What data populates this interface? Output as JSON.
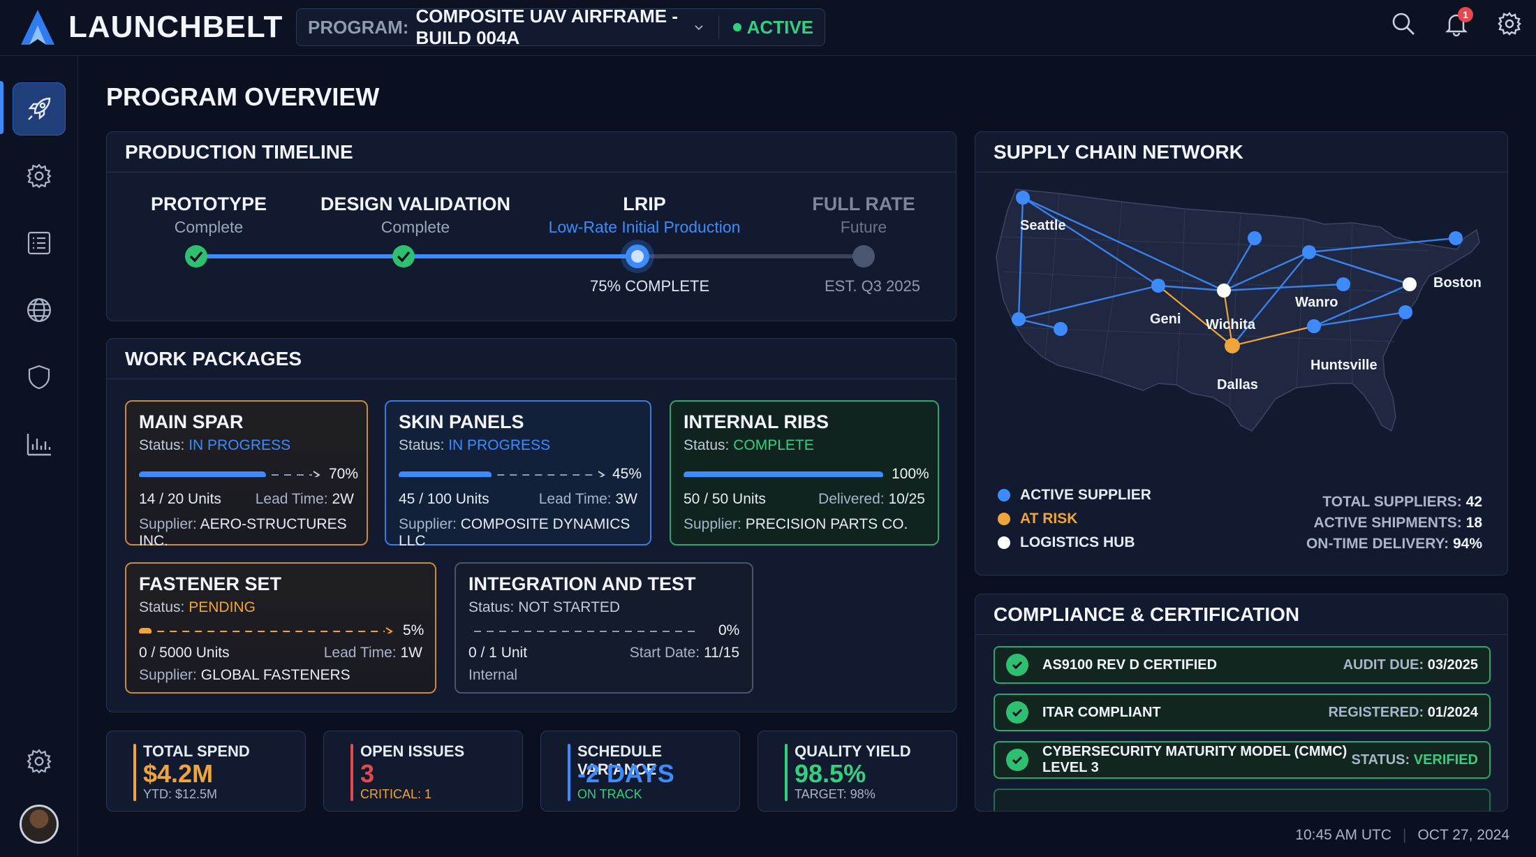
{
  "app": {
    "name": "LAUNCHBELT"
  },
  "program": {
    "label": "PROGRAM:",
    "value": "COMPOSITE UAV AIRFRAME - BUILD 004A",
    "status": "ACTIVE"
  },
  "notifications": {
    "count": "1"
  },
  "colors": {
    "accent": "#3d8bff",
    "success": "#35d07f",
    "warning": "#f0a53a",
    "danger": "#e5484d",
    "background": "#0b1020"
  },
  "icons": {
    "sidebar": [
      "rocket-icon",
      "gear-icon",
      "list-icon",
      "globe-icon",
      "shield-icon",
      "bar-chart-icon",
      "settings-icon"
    ],
    "top": [
      "search-icon",
      "bell-icon",
      "gear-icon"
    ]
  },
  "page": {
    "title": "PROGRAM OVERVIEW"
  },
  "timeline": {
    "title": "PRODUCTION TIMELINE",
    "progress": 0.75,
    "stages": [
      {
        "name": "PROTOTYPE",
        "sub": "Complete",
        "state": "complete"
      },
      {
        "name": "DESIGN VALIDATION",
        "sub": "Complete",
        "state": "complete"
      },
      {
        "name": "LRIP",
        "sub": "Low-Rate Initial Production",
        "state": "current",
        "note": "75% COMPLETE"
      },
      {
        "name": "FULL RATE",
        "sub": "Future",
        "state": "future",
        "note": "EST. Q3 2025"
      }
    ]
  },
  "work_packages": {
    "title": "WORK PACKAGES",
    "status_label": "Status:",
    "supplier_label": "Supplier:",
    "items": [
      {
        "name": "MAIN SPAR",
        "status": "IN PROGRESS",
        "progress": 0.7,
        "pct": "70%",
        "units": "14 / 20 Units",
        "meta_label": "Lead Time:",
        "meta_value": "2W",
        "supplier": "AERO-STRUCTURES INC."
      },
      {
        "name": "SKIN PANELS",
        "status": "IN PROGRESS",
        "progress": 0.45,
        "pct": "45%",
        "units": "45 / 100 Units",
        "meta_label": "Lead Time:",
        "meta_value": "3W",
        "supplier": "COMPOSITE DYNAMICS LLC"
      },
      {
        "name": "INTERNAL RIBS",
        "status": "COMPLETE",
        "progress": 1.0,
        "pct": "100%",
        "units": "50 / 50 Units",
        "meta_label": "Delivered:",
        "meta_value": "10/25",
        "supplier": "PRECISION PARTS CO."
      },
      {
        "name": "FASTENER SET",
        "status": "PENDING",
        "progress": 0.05,
        "pct": "5%",
        "units": "0 / 5000 Units",
        "meta_label": "Lead Time:",
        "meta_value": "1W",
        "supplier": "GLOBAL FASTENERS"
      },
      {
        "name": "INTEGRATION AND TEST",
        "status": "NOT STARTED",
        "progress": 0.0,
        "pct": "0%",
        "units": "0 / 1 Unit",
        "meta_label": "Start Date:",
        "meta_value": "11/15",
        "supplier": "Internal"
      }
    ]
  },
  "kpis": [
    {
      "label": "TOTAL SPEND",
      "value": "$4.2M",
      "sub": "YTD: $12.5M",
      "color": "#f0a53a"
    },
    {
      "label": "OPEN ISSUES",
      "value": "3",
      "sub": "CRITICAL: 1",
      "color": "#e5484d"
    },
    {
      "label": "SCHEDULE VARIANCE",
      "value": "-2 DAYS",
      "sub": "ON TRACK",
      "color": "#3d8bff"
    },
    {
      "label": "QUALITY YIELD",
      "value": "98.5%",
      "sub": "TARGET: 98%",
      "color": "#35d07f"
    }
  ],
  "supply_chain": {
    "title": "SUPPLY CHAIN NETWORK",
    "cities": [
      "Seattle",
      "Boston",
      "Wanro",
      "Geni",
      "Wichita",
      "Huntsville",
      "Dallas"
    ],
    "legend": [
      "ACTIVE SUPPLIER",
      "AT RISK",
      "LOGISTICS HUB"
    ],
    "stats": [
      {
        "label": "TOTAL SUPPLIERS:",
        "value": "42"
      },
      {
        "label": "ACTIVE SHIPMENTS:",
        "value": "18"
      },
      {
        "label": "ON-TIME DELIVERY:",
        "value": "94%"
      }
    ]
  },
  "compliance": {
    "title": "COMPLIANCE & CERTIFICATION",
    "items": [
      {
        "name": "AS9100 REV D CERTIFIED",
        "right_label": "AUDIT DUE:",
        "right_value": "03/2025"
      },
      {
        "name": "ITAR COMPLIANT",
        "right_label": "REGISTERED:",
        "right_value": "01/2024"
      },
      {
        "name": "CYBERSECURITY MATURITY MODEL (CMMC) LEVEL 3",
        "right_label": "STATUS:",
        "right_value": "VERIFIED"
      }
    ]
  },
  "footer": {
    "time": "10:45 AM UTC",
    "date": "OCT 27, 2024"
  }
}
